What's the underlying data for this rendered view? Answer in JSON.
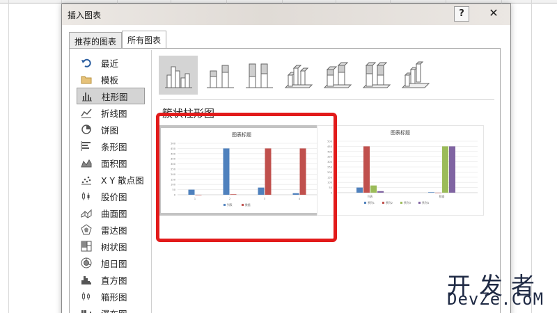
{
  "dialog": {
    "title": "插入图表",
    "help_label": "?",
    "close_label": "✕",
    "tabs": [
      {
        "label": "推荐的图表"
      },
      {
        "label": "所有图表"
      }
    ]
  },
  "sidebar": {
    "items": [
      {
        "label": "最近",
        "icon": "undo-arrow-icon"
      },
      {
        "label": "模板",
        "icon": "folder-icon"
      },
      {
        "label": "柱形图",
        "icon": "column-chart-icon"
      },
      {
        "label": "折线图",
        "icon": "line-chart-icon"
      },
      {
        "label": "饼图",
        "icon": "pie-chart-icon"
      },
      {
        "label": "条形图",
        "icon": "bar-chart-icon"
      },
      {
        "label": "面积图",
        "icon": "area-chart-icon"
      },
      {
        "label": "X Y 散点图",
        "icon": "scatter-chart-icon"
      },
      {
        "label": "股价图",
        "icon": "stock-chart-icon"
      },
      {
        "label": "曲面图",
        "icon": "surface-chart-icon"
      },
      {
        "label": "雷达图",
        "icon": "radar-chart-icon"
      },
      {
        "label": "树状图",
        "icon": "treemap-chart-icon"
      },
      {
        "label": "旭日图",
        "icon": "sunburst-chart-icon"
      },
      {
        "label": "直方图",
        "icon": "histogram-chart-icon"
      },
      {
        "label": "箱形图",
        "icon": "box-whisker-chart-icon"
      },
      {
        "label": "瀑布图",
        "icon": "waterfall-chart-icon"
      }
    ]
  },
  "section_heading": "簇状柱形图",
  "colors": {
    "blue": "#4f81bd",
    "red": "#c0504d",
    "green": "#9bbb59",
    "purple": "#8064a2",
    "highlight": "#e21b1b"
  },
  "chart_data": [
    {
      "type": "bar",
      "title": "图表标题",
      "categories": [
        "1",
        "2",
        "3",
        "4"
      ],
      "series": [
        {
          "name": "列表",
          "values": [
            50,
            450,
            70,
            15
          ]
        },
        {
          "name": "数据",
          "values": [
            0,
            5,
            450,
            450
          ]
        }
      ],
      "ylim": [
        0,
        500
      ],
      "yticks": [
        "0",
        "50",
        "100",
        "150",
        "200",
        "250",
        "300",
        "350",
        "400",
        "450",
        "500"
      ],
      "legend": "bottom",
      "grid": true
    },
    {
      "type": "bar",
      "title": "图表标题",
      "categories": [
        "列表",
        "数据"
      ],
      "series": [
        {
          "name": "系列1",
          "values": [
            50,
            5
          ]
        },
        {
          "name": "系列2",
          "values": [
            450,
            0
          ]
        },
        {
          "name": "系列3",
          "values": [
            70,
            450
          ]
        },
        {
          "name": "系列4",
          "values": [
            15,
            450
          ]
        }
      ],
      "ylim": [
        0,
        500
      ],
      "yticks": [
        "0",
        "50",
        "100",
        "150",
        "200",
        "250",
        "300",
        "350",
        "400",
        "450",
        "500"
      ],
      "legend": "bottom",
      "grid": true
    }
  ],
  "watermark": {
    "line1": "开发者",
    "line2": "DevZe.CoM"
  }
}
